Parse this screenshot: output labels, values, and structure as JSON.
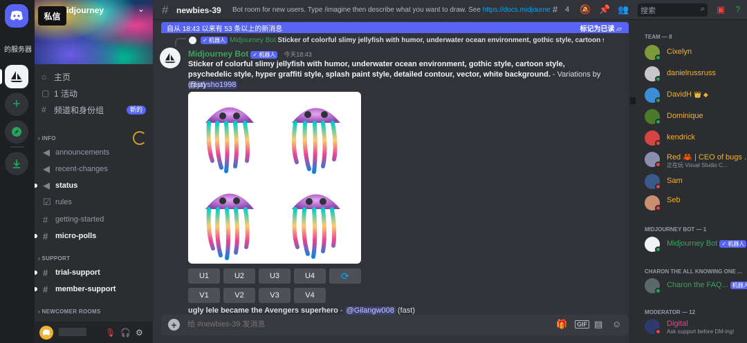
{
  "rail": {
    "servers_label": "的服务器"
  },
  "sidebar": {
    "server_name": "idjourney",
    "dm_tooltip": "私信",
    "nav": [
      {
        "label": "主页"
      },
      {
        "label": "1 活动"
      },
      {
        "label": "频道和身份组",
        "badge": "新的"
      }
    ],
    "categories": {
      "info": "INFO",
      "support": "SUPPORT",
      "newcomer": "NEWCOMER ROOMS"
    },
    "info_channels": [
      {
        "label": "announcements",
        "icon": "megaphone-icon",
        "unread": false
      },
      {
        "label": "recent-changes",
        "icon": "megaphone-icon",
        "unread": false
      },
      {
        "label": "status",
        "icon": "megaphone-icon",
        "unread": true
      },
      {
        "label": "rules",
        "icon": "checkbox-icon",
        "unread": false
      },
      {
        "label": "getting-started",
        "icon": "hash-icon",
        "unread": false
      },
      {
        "label": "micro-polls",
        "icon": "hash-icon",
        "unread": true
      }
    ],
    "support_channels": [
      {
        "label": "trial-support",
        "unread": true
      },
      {
        "label": "member-support",
        "unread": true
      }
    ]
  },
  "header": {
    "channel": "newbies-39",
    "topic_text": "Bot room for new users. Type /imagine then describe what you want to draw. See ",
    "topic_link": "https://docs.midjourney...",
    "threads_count": "4",
    "search_placeholder": "搜索"
  },
  "messages": {
    "new_bar": "自从 18:43 以来有 53 条以上的新消息",
    "mark_read": "标记为已读",
    "reply": {
      "name": "Midjourney Bot",
      "bot_tag": "✓ 机器人",
      "text": "Sticker of colorful slimy jellyfish with humor, underwater ocean environment, gothic style, cartoon style, ps"
    },
    "main": {
      "author": "Midjourney Bot",
      "bot_tag": "✓ 机器人",
      "time": "今天18:43",
      "prompt": "Sticker of colorful slimy jellyfish with humor, underwater ocean environment, gothic style, cartoon style, psychedelic style, hyper graffiti style, splash paint style, detailed contour, vector, white background.",
      "suffix": " - Variations by ",
      "mention": "@jaysho1998",
      "speed": "(fast)"
    },
    "upscale_buttons": [
      "U1",
      "U2",
      "U3",
      "U4"
    ],
    "variation_buttons": [
      "V1",
      "V2",
      "V3",
      "V4"
    ],
    "reroll_icon": "refresh-icon",
    "next": {
      "text": "ugly lele became the Avengers superhero",
      "suffix": " - ",
      "mention": "@Gilangw008",
      "speed": " (fast)"
    }
  },
  "composer": {
    "placeholder": "给 #newbies-39 发消息"
  },
  "members": {
    "team_header": "TEAM — 8",
    "team": [
      {
        "name": "Cixelyn",
        "color": "#f0b232",
        "avatar": "#7a9a3c",
        "status": "#23a55a"
      },
      {
        "name": "danielrussruss",
        "color": "#f0b232",
        "avatar": "#c8c8c8",
        "status": "#23a55a"
      },
      {
        "name": "DavidH",
        "color": "#f0b232",
        "avatar": "#3b8dd6",
        "status": "#23a55a",
        "badges": "👑 ◆"
      },
      {
        "name": "Dominique",
        "color": "#f0b232",
        "avatar": "#4a7a2a",
        "status": "#23a55a"
      },
      {
        "name": "kendrick",
        "color": "#f0b232",
        "avatar": "#d64545",
        "status": "#f23f43"
      },
      {
        "name": "Red 🦀 | CEO of bugs ...",
        "color": "#f0b232",
        "avatar": "#8a8fb0",
        "status": "#f23f43",
        "sub": "正在玩 Visual Studio C..."
      },
      {
        "name": "Sam",
        "color": "#f0b232",
        "avatar": "#3a5a8a",
        "status": "#f23f43"
      },
      {
        "name": "Seb",
        "color": "#f0b232",
        "avatar": "#c89070",
        "status": "#f23f43"
      }
    ],
    "bot_header": "MIDJOURNEY BOT — 1",
    "bots": [
      {
        "name": "Midjourney Bot",
        "tag": "✓ 机器人",
        "color": "#3ba55d"
      }
    ],
    "charon_header": "CHARON THE ALL KNOWING ONE ...",
    "charon": [
      {
        "name": "Charon the FAQ...",
        "tag": "机器人",
        "color": "#3ba55d"
      }
    ],
    "mod_header": "MODERATOR — 12",
    "mods": [
      {
        "name": "Digital",
        "sub": "Ask support before DM-ing!",
        "color": "#e84393"
      }
    ]
  }
}
